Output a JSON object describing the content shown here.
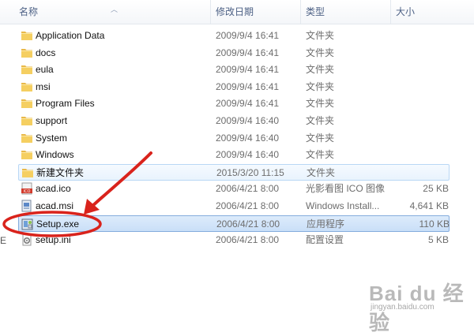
{
  "columns": {
    "name": "名称",
    "date": "修改日期",
    "type": "类型",
    "size": "大小"
  },
  "files": [
    {
      "name": "Application Data",
      "date": "2009/9/4 16:41",
      "type": "文件夹",
      "size": "",
      "icon": "folder-icon"
    },
    {
      "name": "docs",
      "date": "2009/9/4 16:41",
      "type": "文件夹",
      "size": "",
      "icon": "folder-icon"
    },
    {
      "name": "eula",
      "date": "2009/9/4 16:41",
      "type": "文件夹",
      "size": "",
      "icon": "folder-icon"
    },
    {
      "name": "msi",
      "date": "2009/9/4 16:41",
      "type": "文件夹",
      "size": "",
      "icon": "folder-icon"
    },
    {
      "name": "Program Files",
      "date": "2009/9/4 16:41",
      "type": "文件夹",
      "size": "",
      "icon": "folder-icon"
    },
    {
      "name": "support",
      "date": "2009/9/4 16:40",
      "type": "文件夹",
      "size": "",
      "icon": "folder-icon"
    },
    {
      "name": "System",
      "date": "2009/9/4 16:40",
      "type": "文件夹",
      "size": "",
      "icon": "folder-icon"
    },
    {
      "name": "Windows",
      "date": "2009/9/4 16:40",
      "type": "文件夹",
      "size": "",
      "icon": "folder-icon"
    },
    {
      "name": "新建文件夹",
      "date": "2015/3/20 11:15",
      "type": "文件夹",
      "size": "",
      "icon": "folder-icon",
      "state": "hover"
    },
    {
      "name": "acad.ico",
      "date": "2006/4/21 8:00",
      "type": "光影看图 ICO 图像",
      "size": "25 KB",
      "icon": "ico-file-icon"
    },
    {
      "name": "acad.msi",
      "date": "2006/4/21 8:00",
      "type": "Windows Install...",
      "size": "4,641 KB",
      "icon": "msi-installer-icon"
    },
    {
      "name": "Setup.exe",
      "date": "2006/4/21 8:00",
      "type": "应用程序",
      "size": "110 KB",
      "icon": "exe-setup-icon",
      "state": "selected"
    },
    {
      "name": "setup.ini",
      "date": "2006/4/21 8:00",
      "type": "配置设置",
      "size": "5 KB",
      "icon": "ini-settings-icon"
    }
  ],
  "colors": {
    "annotation_red": "#d9231c",
    "selection_border": "#84acdd",
    "header_text": "#4d6185"
  },
  "watermark": {
    "brand": "Bai du 经验",
    "url": "jingyan.baidu.com"
  },
  "edge_mark": "E"
}
